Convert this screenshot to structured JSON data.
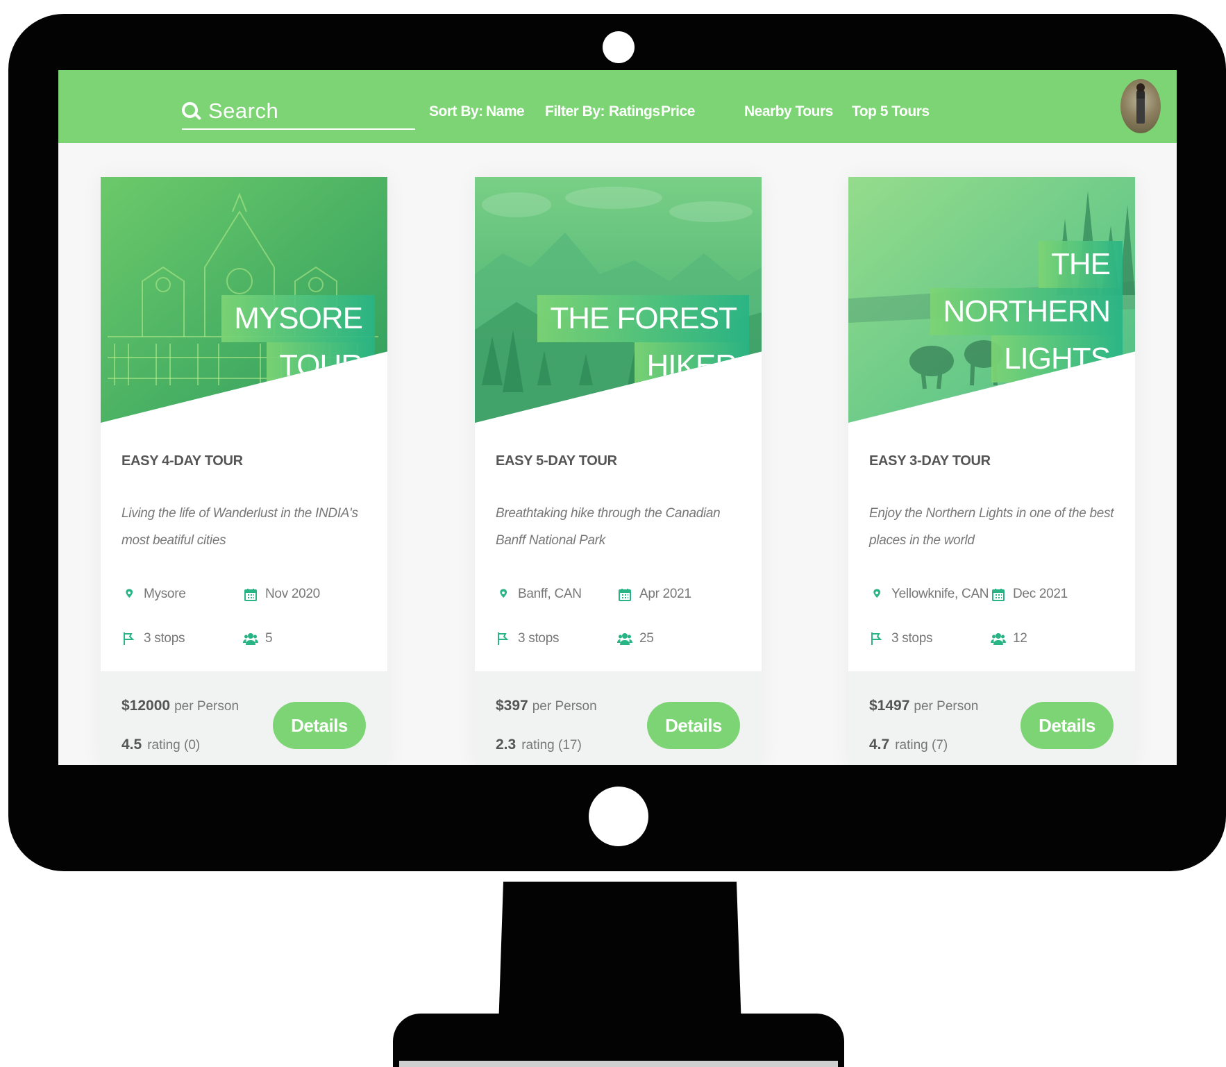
{
  "header": {
    "search_label": "Search",
    "sort_by_label": "Sort By:",
    "sort_name": "Name",
    "filter_by_label": "Filter By:",
    "filter_ratings": "Ratings",
    "filter_price": "Price",
    "nearby_tours": "Nearby Tours",
    "top_tours": "Top 5 Tours"
  },
  "colors": {
    "brand_green": "#7dd474",
    "accent_teal": "#28b485"
  },
  "cards": [
    {
      "title_lines": [
        "MYSORE",
        "TOUR"
      ],
      "subtitle": "EASY 4-DAY TOUR",
      "description": "Living the life of Wanderlust in the INDIA's most beatiful cities",
      "location": "Mysore",
      "date": "Nov 2020",
      "stops": "3 stops",
      "people": "5",
      "price": "$12000",
      "price_suffix": "per Person",
      "rating": "4.5",
      "rating_suffix": "rating (0)",
      "details_label": "Details"
    },
    {
      "title_lines": [
        "THE FOREST",
        "HIKER"
      ],
      "subtitle": "EASY 5-DAY TOUR",
      "description": "Breathtaking hike through the Canadian Banff National Park",
      "location": "Banff, CAN",
      "date": "Apr 2021",
      "stops": "3 stops",
      "people": "25",
      "price": "$397",
      "price_suffix": "per Person",
      "rating": "2.3",
      "rating_suffix": "rating (17)",
      "details_label": "Details"
    },
    {
      "title_lines": [
        "THE",
        "NORTHERN",
        "LIGHTS"
      ],
      "subtitle": "EASY 3-DAY TOUR",
      "description": "Enjoy the Northern Lights in one of the best places in the world",
      "location": "Yellowknife, CAN",
      "date": "Dec 2021",
      "stops": "3 stops",
      "people": "12",
      "price": "$1497",
      "price_suffix": "per Person",
      "rating": "4.7",
      "rating_suffix": "rating (7)",
      "details_label": "Details"
    }
  ]
}
